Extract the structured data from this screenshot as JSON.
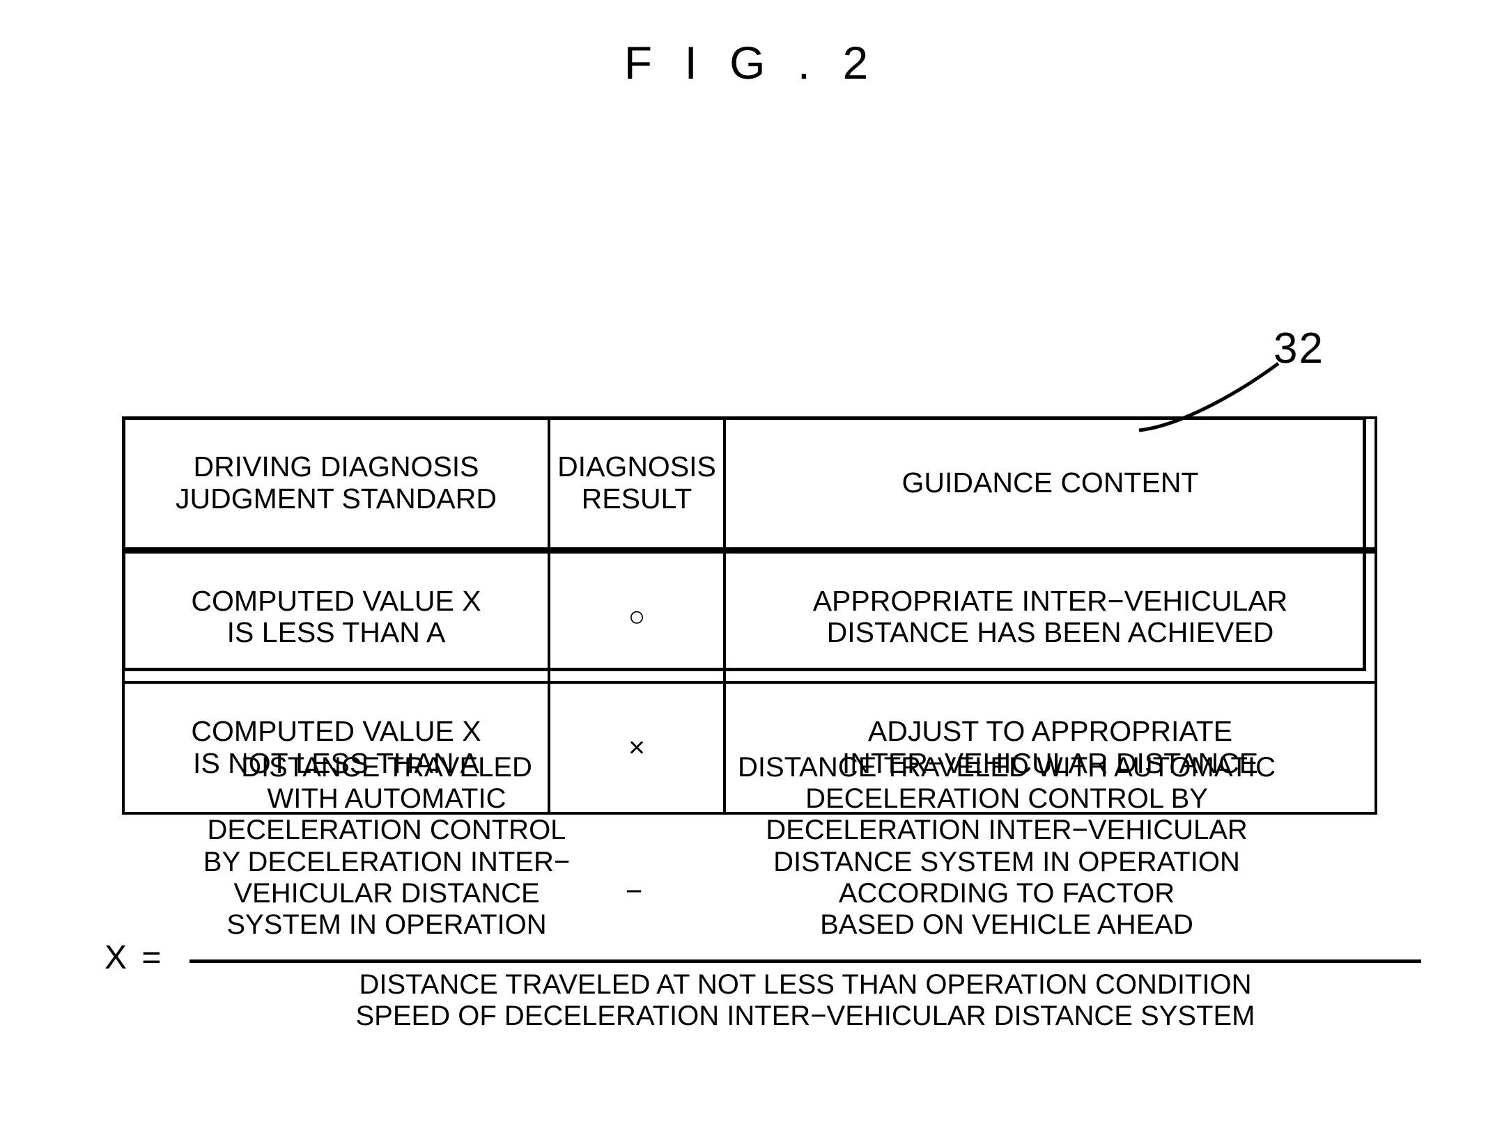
{
  "figure": {
    "title": "F I G . 2",
    "reference_numeral": "32"
  },
  "table": {
    "columns": [
      "DRIVING DIAGNOSIS\nJUDGMENT STANDARD",
      "DIAGNOSIS\nRESULT",
      "GUIDANCE CONTENT"
    ],
    "rows": [
      {
        "standard": "COMPUTED VALUE X\nIS LESS THAN A",
        "result": "○",
        "result_name": "circle-ok-symbol",
        "guidance": "APPROPRIATE INTER−VEHICULAR\nDISTANCE HAS BEEN ACHIEVED"
      },
      {
        "standard": "COMPUTED VALUE X\nIS NOT LESS THAN A",
        "result": "×",
        "result_name": "cross-ng-symbol",
        "guidance": "ADJUST TO APPROPRIATE\nINTER−VEHICULAR DISTANCE"
      }
    ]
  },
  "formula": {
    "variable": "X =",
    "numerator_left": "DISTANCE TRAVELED\nWITH AUTOMATIC\nDECELERATION CONTROL\nBY DECELERATION INTER−\nVEHICULAR DISTANCE\nSYSTEM IN OPERATION",
    "operator": "−",
    "numerator_right": "DISTANCE TRAVELED WITH AUTOMATIC\nDECELERATION CONTROL BY\nDECELERATION INTER−VEHICULAR\nDISTANCE SYSTEM IN OPERATION\nACCORDING TO FACTOR\nBASED ON VEHICLE AHEAD",
    "denominator": "DISTANCE TRAVELED AT NOT LESS THAN OPERATION CONDITION\nSPEED OF DECELERATION INTER−VEHICULAR DISTANCE SYSTEM"
  },
  "colors": {
    "ink": "#000000",
    "paper": "#ffffff"
  }
}
